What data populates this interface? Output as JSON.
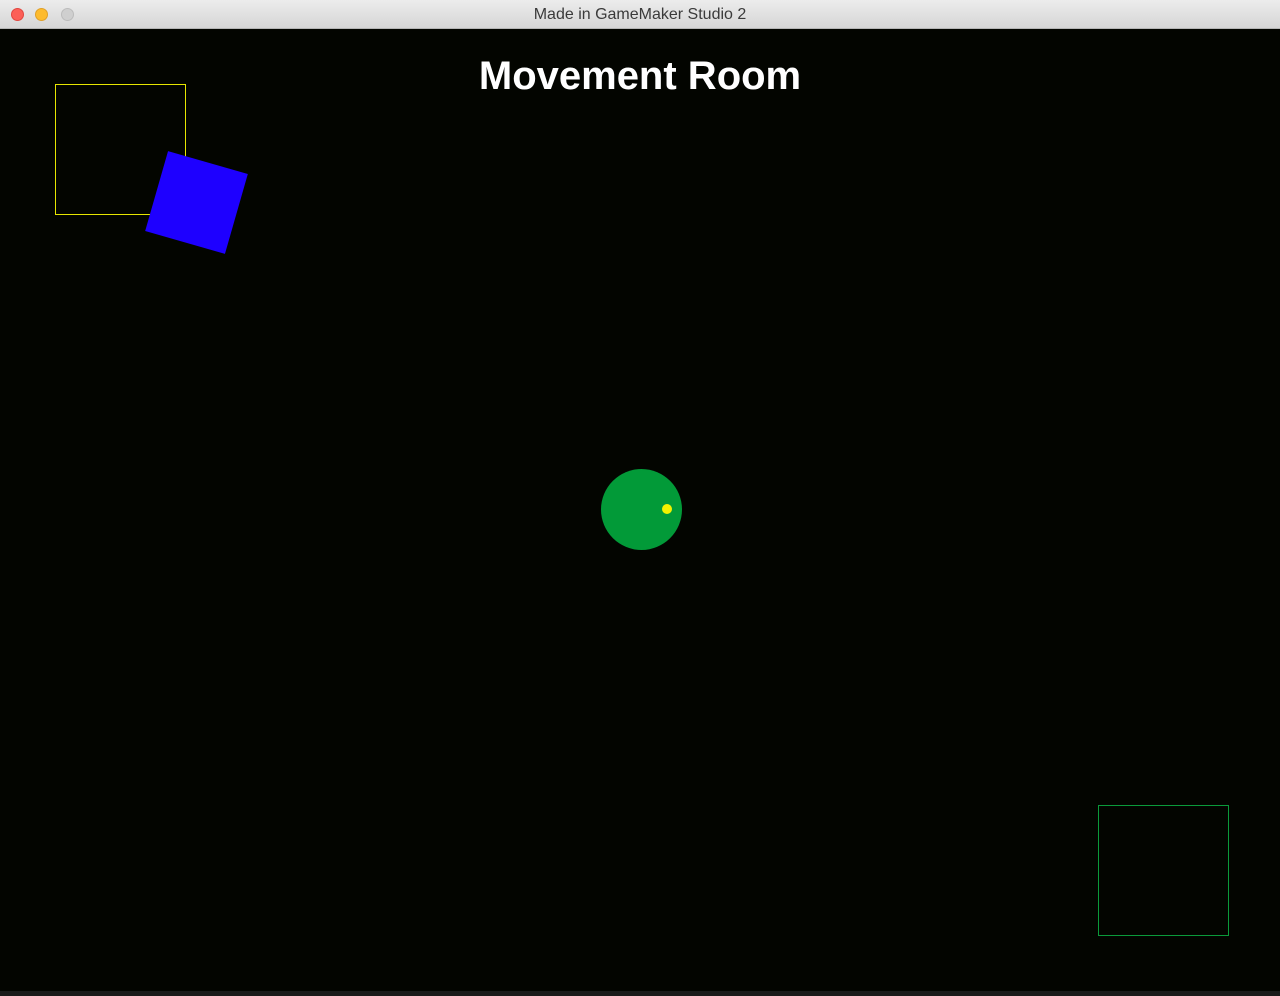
{
  "window": {
    "title": "Made in GameMaker Studio 2",
    "controls": [
      "close",
      "minimize",
      "zoom"
    ]
  },
  "game": {
    "room_title": "Movement Room",
    "colors": {
      "background": "#030500",
      "start_zone_outline": "#e6e600",
      "goal_zone_outline": "#0a9a3a",
      "obstacle": "#1e00ff",
      "player": "#029a38",
      "player_eye": "#f2f200"
    },
    "objects": [
      "start-zone",
      "blue-square-obstacle",
      "player-circle",
      "goal-zone"
    ]
  }
}
